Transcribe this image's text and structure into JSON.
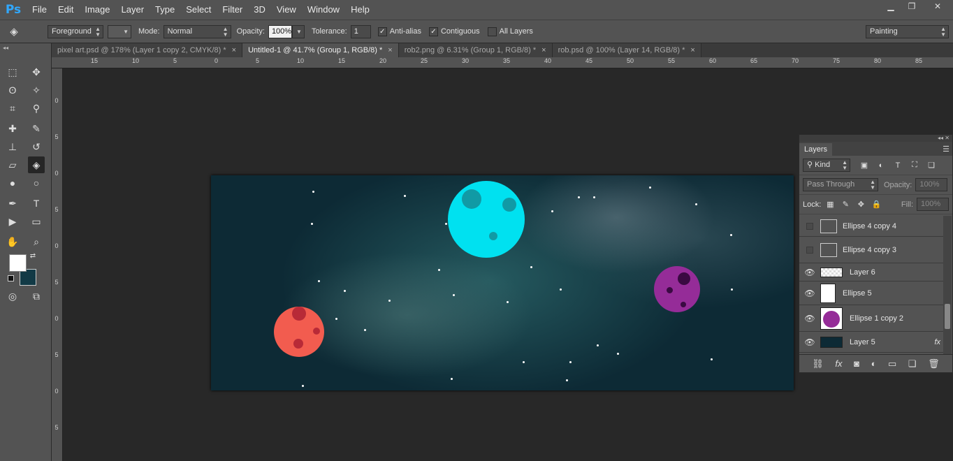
{
  "app_logo": "Ps",
  "menu": [
    "File",
    "Edit",
    "Image",
    "Layer",
    "Type",
    "Select",
    "Filter",
    "3D",
    "View",
    "Window",
    "Help"
  ],
  "window_controls": {
    "minimize": "▁",
    "restore": "❐",
    "close": "✕"
  },
  "options": {
    "fill_source": "Foreground",
    "mode_label": "Mode:",
    "mode_value": "Normal",
    "opacity_label": "Opacity:",
    "opacity_value": "100%",
    "tolerance_label": "Tolerance:",
    "tolerance_value": "1",
    "antialias_label": "Anti-alias",
    "contiguous_label": "Contiguous",
    "all_layers_label": "All Layers",
    "workspace": "Painting"
  },
  "tabs": [
    {
      "label": "pixel art.psd @ 178% (Layer 1 copy 2, CMYK/8) *",
      "close": "×"
    },
    {
      "label": "Untitled-1 @ 41.7% (Group 1, RGB/8) *",
      "close": "×"
    },
    {
      "label": "rob2.png @ 6.31% (Group 1, RGB/8) *",
      "close": "×"
    },
    {
      "label": "rob.psd @ 100% (Layer 14, RGB/8) *",
      "close": "×"
    }
  ],
  "ruler_top": [
    "15",
    "10",
    "5",
    "0",
    "5",
    "10",
    "15",
    "20",
    "25",
    "30",
    "35",
    "40",
    "45",
    "50",
    "55",
    "60",
    "65",
    "70",
    "75",
    "80",
    "85"
  ],
  "ruler_left": [
    "0",
    "5",
    "0",
    "5",
    "0",
    "5",
    "0",
    "5",
    "0",
    "5",
    "0"
  ],
  "tools": {
    "move": "✥",
    "marquee": "⬚",
    "lasso": "ʘ",
    "wand": "✧",
    "crop": "⌗",
    "eyedropper": "⚲",
    "heal": "✚",
    "brush": "✎",
    "stamp": "⊥",
    "history": "↺",
    "eraser": "▱",
    "bucket": "◈",
    "blur": "●",
    "dodge": "○",
    "pen": "✒",
    "type": "T",
    "path_select": "▶",
    "shape": "▭",
    "hand": "✋",
    "zoom": "⌕",
    "swap": "⇄",
    "quickmask": "◎",
    "screen": "⧉"
  },
  "colors": {
    "foreground": "#ffffff",
    "background": "#123a46",
    "planet_cyan": "#00e1f0",
    "planet_red": "#f25c4f",
    "planet_purple": "#952c98"
  },
  "layers_panel": {
    "tab": "Layers",
    "kind_label": "Kind",
    "blend_mode": "Pass Through",
    "opacity_label": "Opacity:",
    "opacity_value": "100%",
    "lock_label": "Lock:",
    "fill_label": "Fill:",
    "fill_value": "100%",
    "filter_icons": [
      "▣",
      "◐",
      "T",
      "⛶",
      "❏"
    ],
    "lock_icons": [
      "▦",
      "✎",
      "✥",
      "🔒"
    ],
    "footer_icons": [
      "⛓",
      "fx",
      "◙",
      "◐",
      "▭",
      "❏",
      "🗑"
    ],
    "layers": [
      {
        "name": "Ellipse 4 copy 4",
        "visible": false
      },
      {
        "name": "Ellipse 4 copy 3",
        "visible": false
      },
      {
        "name": "Layer 6",
        "visible": true
      },
      {
        "name": "Ellipse 5",
        "visible": true
      },
      {
        "name": "Ellipse 1 copy 2",
        "visible": true
      },
      {
        "name": "Layer 5",
        "visible": true,
        "fx": "fx"
      }
    ]
  }
}
